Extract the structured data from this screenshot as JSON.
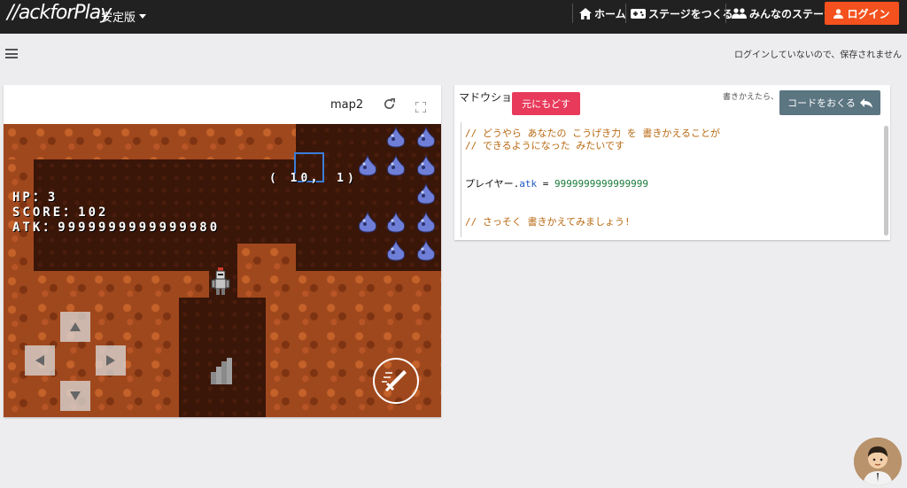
{
  "header": {
    "logo": "//ackforPlay",
    "edition": "安定版",
    "nav": [
      {
        "label": "ホーム",
        "icon": "home-icon"
      },
      {
        "label": "ステージをつくる",
        "icon": "gamepad-icon"
      },
      {
        "label": "みんなのステージ",
        "icon": "people-icon"
      }
    ],
    "login_label": "ログイン"
  },
  "toolbar": {
    "save_note": "ログインしていないので、保存されません"
  },
  "game": {
    "map_name": "map2",
    "hud": {
      "hp": "HP：3",
      "score": "SCORE：102",
      "atk": "ATK：9999999999999980"
    },
    "coords": "( 10，  1)"
  },
  "code_panel": {
    "title": "マドウショ",
    "revert_label": "元にもどす",
    "rewrite_note": "書きかえたら、",
    "send_label": "コードをおくる",
    "lines": {
      "c1": "// どうやら あなたの こうげき力 を 書きかえることが",
      "c2": "// できるようになった みたいです",
      "obj": "プレイヤー",
      "dot": ".",
      "prop": "atk",
      "op": " = ",
      "num": "9999999999999999",
      "c3": "// さっそく 書きかえてみましょう!"
    }
  },
  "colors": {
    "topbar": "#212121",
    "login": "#f4511e",
    "revert": "#e83a5b",
    "send": "#5b7581",
    "comment": "#b86912"
  }
}
